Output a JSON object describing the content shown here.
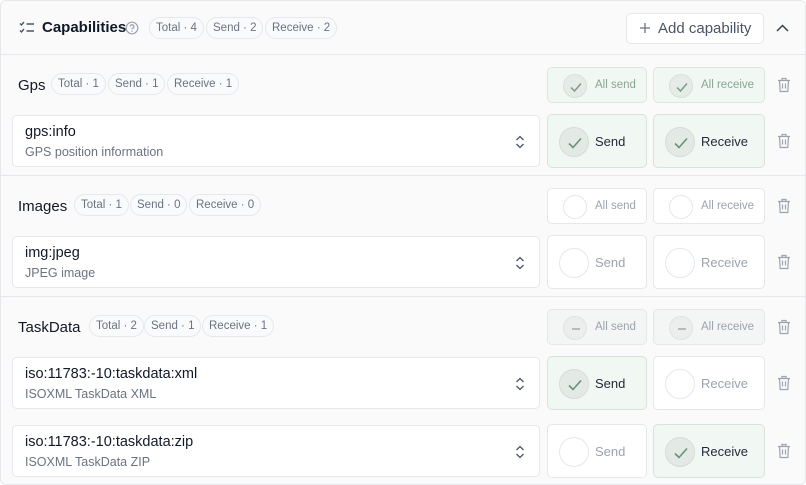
{
  "header": {
    "title": "Capabilities",
    "pills": [
      "Total · 4",
      "Send · 2",
      "Receive · 2"
    ],
    "add_label": "Add capability"
  },
  "icons": {
    "list": "checklist-icon",
    "help": "question-circle-icon",
    "plus": "plus-icon",
    "collapse": "chevron-up-icon",
    "check": "check-icon",
    "minus": "minus-icon",
    "trash": "trash-icon",
    "select": "chevron-up-down-icon"
  },
  "colors": {
    "accent_bg": "#f1f7f3",
    "check": "#6b8f7a"
  },
  "groups": [
    {
      "name": "Gps",
      "pills": [
        "Total · 1",
        "Send · 1",
        "Receive · 1"
      ],
      "all_send_label": "All send",
      "all_receive_label": "All receive",
      "all_send_state": "on",
      "all_receive_state": "on",
      "items": [
        {
          "value": "gps:info",
          "description": "GPS position information",
          "send_label": "Send",
          "receive_label": "Receive",
          "send": true,
          "receive": true
        }
      ]
    },
    {
      "name": "Images",
      "pills": [
        "Total · 1",
        "Send · 0",
        "Receive · 0"
      ],
      "all_send_label": "All send",
      "all_receive_label": "All receive",
      "all_send_state": "off",
      "all_receive_state": "off",
      "items": [
        {
          "value": "img:jpeg",
          "description": "JPEG image",
          "send_label": "Send",
          "receive_label": "Receive",
          "send": false,
          "receive": false
        }
      ]
    },
    {
      "name": "TaskData",
      "pills": [
        "Total · 2",
        "Send · 1",
        "Receive · 1"
      ],
      "all_send_label": "All send",
      "all_receive_label": "All receive",
      "all_send_state": "mixed",
      "all_receive_state": "mixed",
      "items": [
        {
          "value": "iso:11783:-10:taskdata:xml",
          "description": "ISOXML TaskData XML",
          "send_label": "Send",
          "receive_label": "Receive",
          "send": true,
          "receive": false
        },
        {
          "value": "iso:11783:-10:taskdata:zip",
          "description": "ISOXML TaskData ZIP",
          "send_label": "Send",
          "receive_label": "Receive",
          "send": false,
          "receive": true
        }
      ]
    }
  ]
}
